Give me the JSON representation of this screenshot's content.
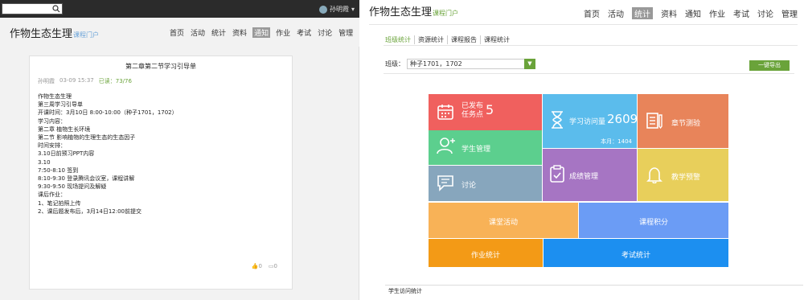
{
  "left": {
    "user": "孙明霞",
    "brand": {
      "title": "作物生态生理",
      "sub": "课程门户"
    },
    "nav": [
      "首页",
      "活动",
      "统计",
      "资料",
      "通知",
      "作业",
      "考试",
      "讨论",
      "管理"
    ],
    "active_nav": "通知",
    "card": {
      "title": "第二章第二节学习引导单",
      "author": "孙明霞",
      "time": "03-09 15:37",
      "read": "已读：73/76",
      "lines": [
        "作物生态生理",
        "第三周学习引导单",
        "开课时间：3月10日 8:00-10:00（种子1701，1702）",
        "学习内容：",
        "第二章 植物生长环境",
        "第二节 影响植物的生理生态的生态因子",
        "时间安排：",
        "3.10日前预习PPT内容",
        "3.10",
        "7:50-8:10 签到",
        "8:10-9:30 登录腾讯会议室，课程讲解",
        "9:30-9:50 现场提问及解疑",
        "课后作业：",
        "1、笔记拍照上传",
        "2、课后题发布后，3月14日12:00前提交"
      ],
      "likes": "0",
      "comments": "0"
    }
  },
  "right": {
    "brand": {
      "title": "作物生态生理",
      "sub": "课程门户"
    },
    "nav": [
      "首页",
      "活动",
      "统计",
      "资料",
      "通知",
      "作业",
      "考试",
      "讨论",
      "管理"
    ],
    "active_nav": "统计",
    "subtabs": [
      "班级统计",
      "资源统计",
      "课程报告",
      "课程统计"
    ],
    "class_label": "班级：",
    "class_value": "种子1701，1702",
    "export_label": "一键导出",
    "tiles": {
      "published": {
        "label1": "已发布",
        "label2": "任务点",
        "value": "5",
        "color": "#f0605e"
      },
      "visits": {
        "label": "学习访问量",
        "value": "2609",
        "month": "本月：1404",
        "color": "#5bbcec"
      },
      "chapter": {
        "label": "章节测验",
        "color": "#e8845a"
      },
      "students": {
        "label": "学生管理",
        "color": "#5ccf8e"
      },
      "grades": {
        "label": "成绩管理",
        "color": "#a675c3"
      },
      "warning": {
        "label": "教学预警",
        "color": "#e8cf5b"
      },
      "discuss": {
        "label": "讨论",
        "color": "#87a6bd"
      },
      "class_activity": {
        "label": "课堂活动",
        "color": "#f8b257"
      },
      "points": {
        "label": "课程积分",
        "color": "#6b9cf5"
      },
      "homework": {
        "label": "作业统计",
        "color": "#f39a16"
      },
      "exam": {
        "label": "考试统计",
        "color": "#1c8ff0"
      }
    },
    "bottom_text": "学生访问统计"
  }
}
